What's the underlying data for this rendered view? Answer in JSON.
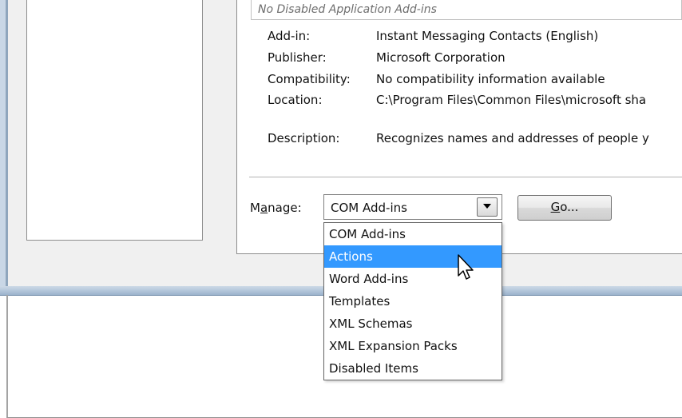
{
  "addins_list": {
    "disabled_placeholder": "No Disabled Application Add-ins"
  },
  "details": {
    "addin_label": "Add-in:",
    "addin_value": "Instant Messaging Contacts (English)",
    "publisher_label": "Publisher:",
    "publisher_value": "Microsoft Corporation",
    "compatibility_label": "Compatibility:",
    "compatibility_value": "No compatibility information available",
    "location_label": "Location:",
    "location_value": "C:\\Program Files\\Common Files\\microsoft sha",
    "description_label": "Description:",
    "description_value": "Recognizes names and addresses of people y"
  },
  "manage": {
    "label_prefix": "M",
    "label_underlined": "a",
    "label_suffix": "nage:",
    "selected": "COM Add-ins",
    "options": [
      "COM Add-ins",
      "Actions",
      "Word Add-ins",
      "Templates",
      "XML Schemas",
      "XML Expansion Packs",
      "Disabled Items"
    ],
    "highlighted_option": "Actions"
  },
  "go_button": {
    "underlined": "G",
    "rest": "o..."
  },
  "icons": {
    "dropdown_arrow": "chevron-down-icon",
    "cursor": "mouse-pointer-icon"
  },
  "colors": {
    "selection": "#3399ff",
    "dialog_background": "#f0f0f0",
    "window_frame": "#9cb3cc"
  }
}
